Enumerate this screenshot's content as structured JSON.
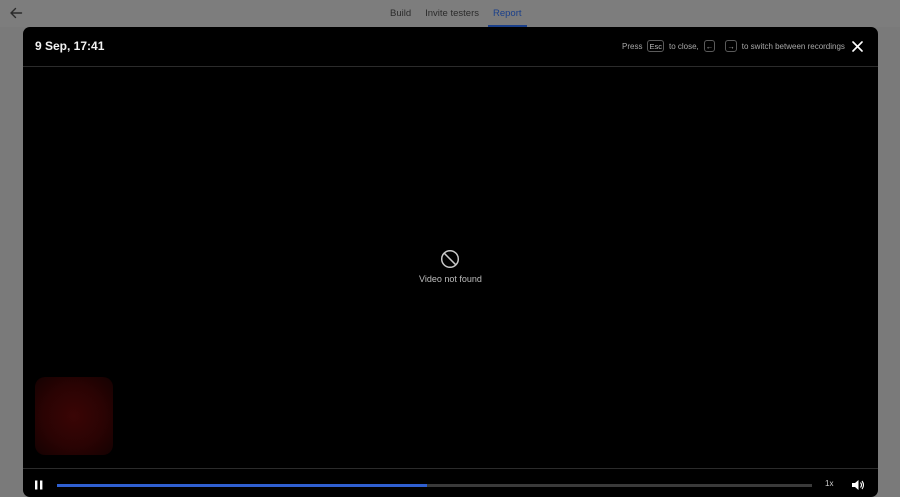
{
  "tabs": [
    {
      "label": "Build",
      "active": false
    },
    {
      "label": "Invite testers",
      "active": false
    },
    {
      "label": "Report",
      "active": true
    }
  ],
  "modal": {
    "title": "9 Sep, 17:41",
    "shortcuts": {
      "press": "Press",
      "esc_key": "Esc",
      "to_close": "to close,",
      "left_key": "←",
      "right_key": "→",
      "to_switch": "to switch between recordings"
    },
    "video_message": "Video not found"
  },
  "player": {
    "progress": 0.49,
    "speed_label": "1x"
  },
  "colors": {
    "accent": "#2f5fd0",
    "tab_active": "#1a3f8a",
    "modal_bg": "#000000"
  },
  "icons": {
    "back": "arrow-left-icon",
    "close": "close-icon",
    "not_found": "prohibited-icon",
    "pause": "pause-icon",
    "volume": "volume-icon"
  }
}
